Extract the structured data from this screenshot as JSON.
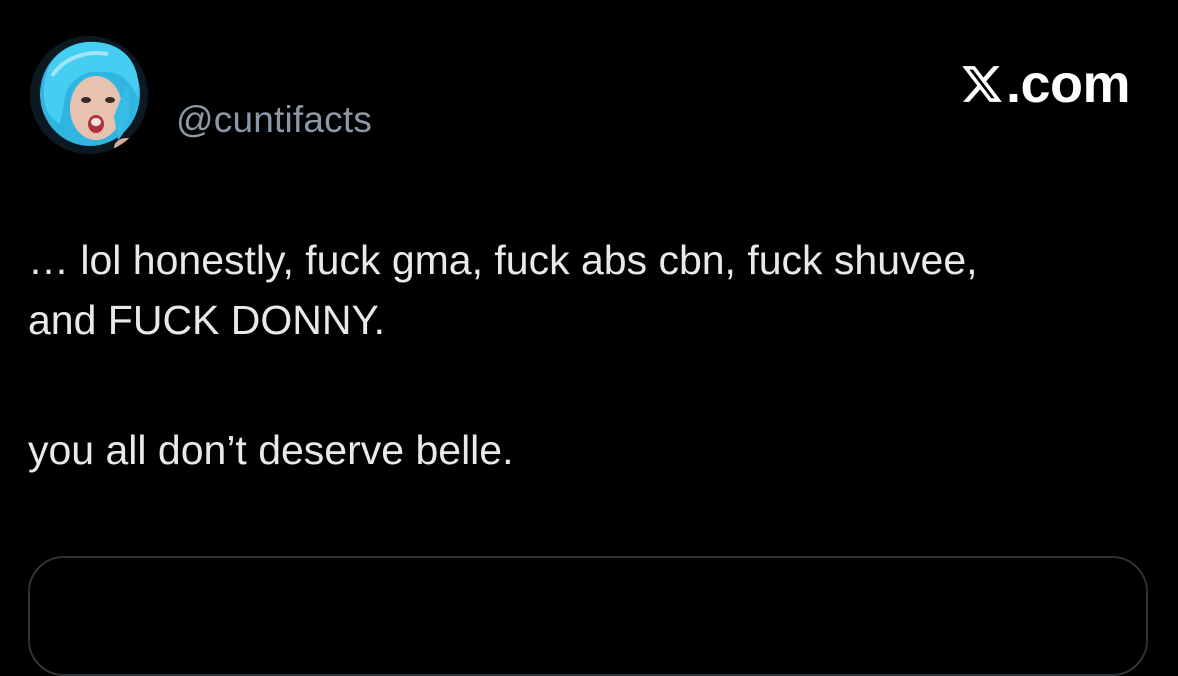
{
  "tweet": {
    "handle": "@cuntifacts",
    "brand": ".com",
    "brand_icon": "x-logo-icon",
    "paragraph_1_line_1": "… lol honestly, fuck gma, fuck abs cbn, fuck shuvee,",
    "paragraph_1_line_2": "and FUCK DONNY.",
    "paragraph_2": "you all don’t deserve belle."
  },
  "colors": {
    "background": "#000000",
    "text": "#e7e9ea",
    "handle": "#8b98a5",
    "border": "#2f3336",
    "avatar_wig": "#3fc6ec"
  }
}
